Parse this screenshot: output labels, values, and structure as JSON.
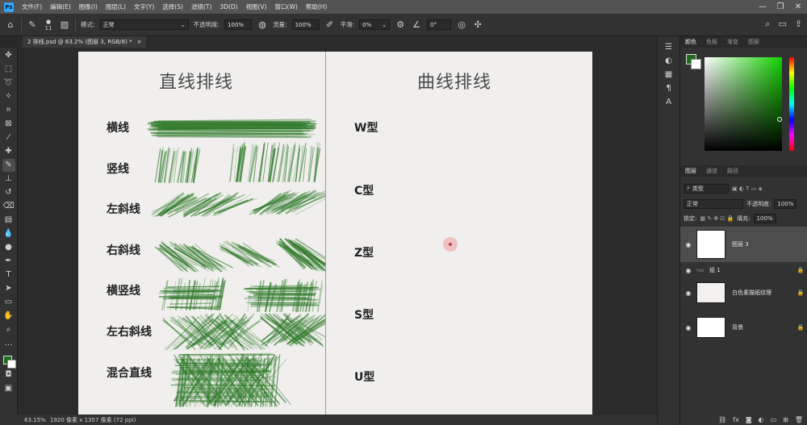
{
  "menu": [
    "文件(F)",
    "编辑(E)",
    "图像(I)",
    "图层(L)",
    "文字(Y)",
    "选择(S)",
    "滤镜(T)",
    "3D(D)",
    "视图(V)",
    "窗口(W)",
    "帮助(H)"
  ],
  "window_buttons": [
    "—",
    "❐",
    "✕"
  ],
  "options": {
    "brush_size": "11",
    "mode_label": "模式:",
    "mode_value": "正常",
    "opacity_label": "不透明度:",
    "opacity_value": "100%",
    "flow_label": "流量:",
    "flow_value": "100%",
    "smoothing_label": "平滑:",
    "smoothing_value": "0%",
    "angle_value": "0°"
  },
  "document_tab": {
    "title": "2 排线.psd @ 63.2% (图层 3, RGB/8) *",
    "close": "×"
  },
  "canvas": {
    "left_title": "直线排线",
    "right_title": "曲线排线",
    "straight_rows": [
      "横线",
      "竖线",
      "左斜线",
      "右斜线",
      "横竖线",
      "左右斜线",
      "混合直线"
    ],
    "curve_rows": [
      "W型",
      "C型",
      "Z型",
      "S型",
      "U型"
    ],
    "stroke_color": "#2f7a2a"
  },
  "status": {
    "zoom": "63.15%",
    "dimensions": "1920 像素 x 1357 像素 (72 ppi)"
  },
  "color_panel": {
    "tabs": [
      "颜色",
      "色板",
      "渐变",
      "图案"
    ],
    "foreground": "#1f6b1a",
    "background": "#ffffff"
  },
  "layers_panel": {
    "tabs": [
      "图层",
      "通道",
      "路径"
    ],
    "filter_label": "类型",
    "blend_mode": "正常",
    "opacity_label": "不透明度:",
    "opacity_value": "100%",
    "lock_label": "锁定:",
    "fill_label": "填充:",
    "fill_value": "100%",
    "layers": [
      {
        "name": "图层 3",
        "selected": true
      },
      {
        "name": "组 1",
        "selected": false
      },
      {
        "name": "白色素描纸纹理",
        "selected": false
      },
      {
        "name": "背景",
        "selected": false
      }
    ]
  }
}
